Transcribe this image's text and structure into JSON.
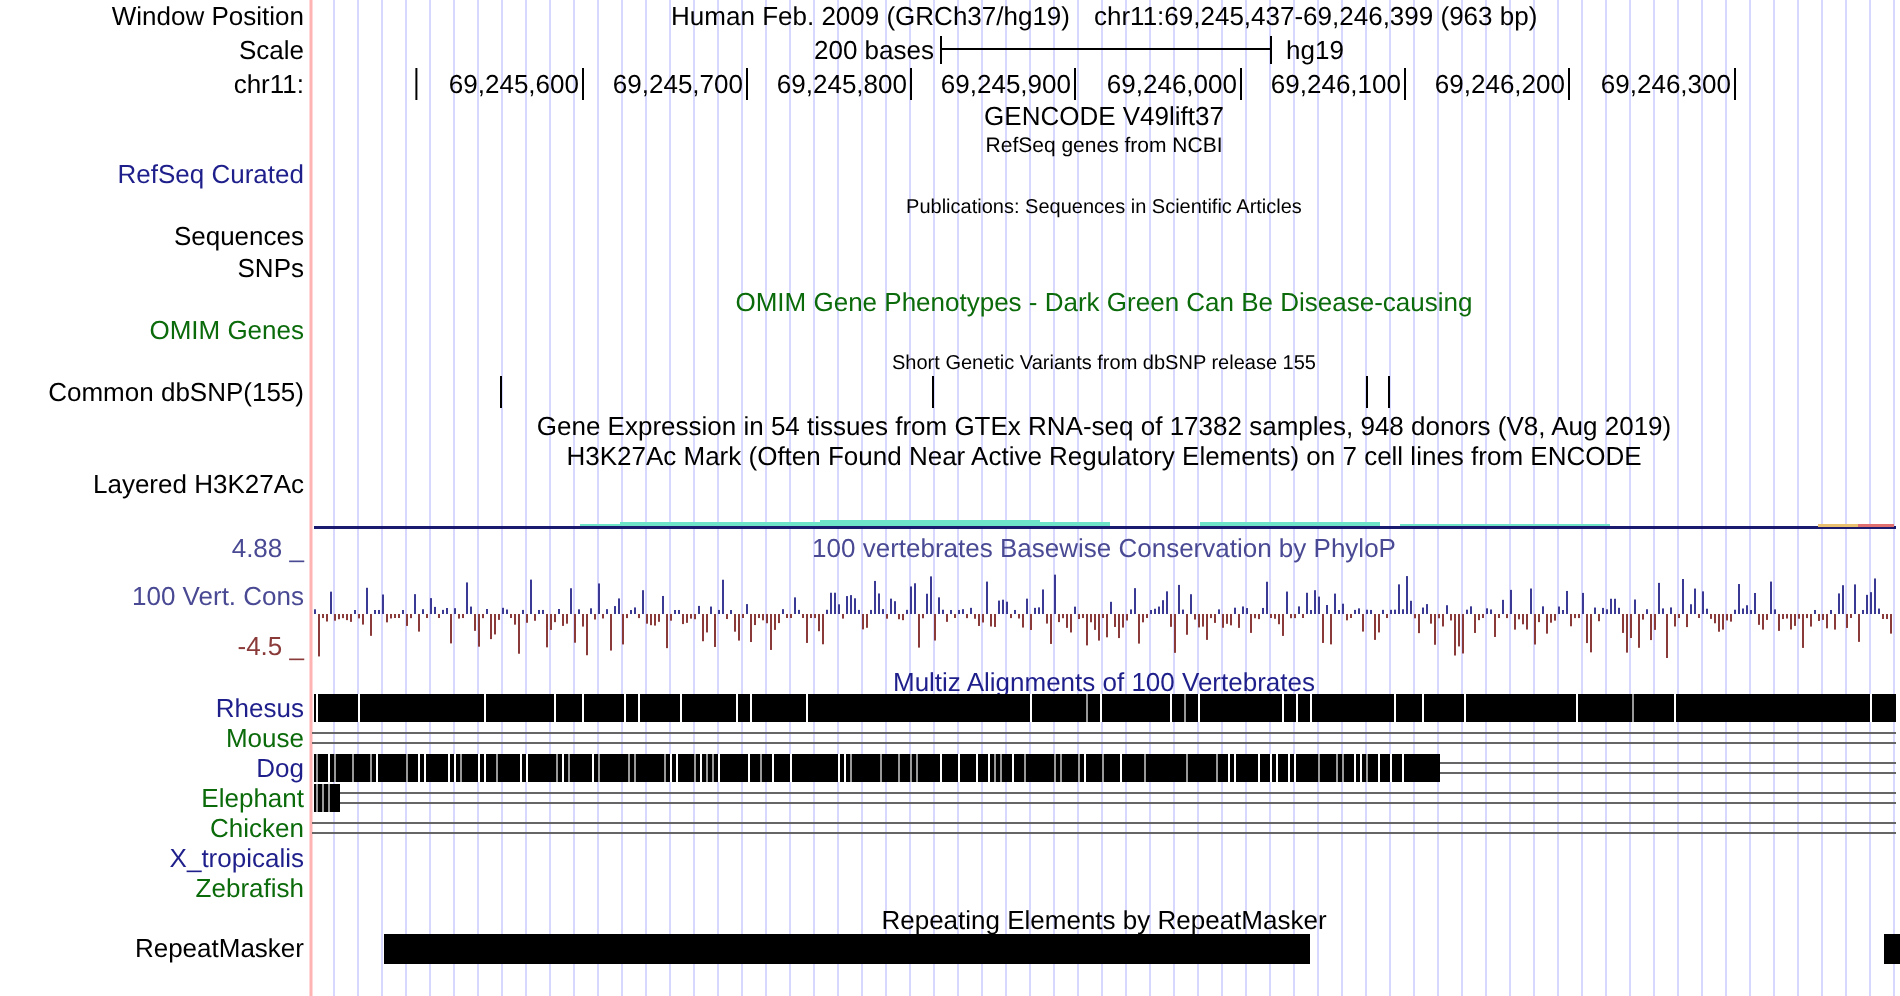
{
  "header": {
    "window_position_label": "Window Position",
    "scale_label": "Scale",
    "chrom_label": "chr11:",
    "assembly": "Human Feb. 2009 (GRCh37/hg19)",
    "position": "chr11:69,245,437-69,246,399 (963 bp)",
    "scale_text": "200 bases",
    "scale_db": "hg19",
    "ruler_ticks": [
      "69,245,600",
      "69,245,700",
      "69,245,800",
      "69,245,900",
      "69,246,000",
      "69,246,100",
      "69,246,200",
      "69,246,300"
    ]
  },
  "tracks": [
    {
      "kind": "gencode",
      "title": "GENCODE V49lift37"
    },
    {
      "kind": "refseq",
      "title": "RefSeq genes from NCBI",
      "label": "RefSeq Curated",
      "color": "#1f1f8c"
    },
    {
      "kind": "publications",
      "title": "Publications: Sequences in Scientific Articles",
      "labels": [
        "Sequences",
        "SNPs"
      ],
      "color": "#000000"
    },
    {
      "kind": "omim",
      "title": "OMIM Gene Phenotypes - Dark Green Can Be Disease-causing",
      "label": "OMIM Genes",
      "color": "#0b6b0b"
    },
    {
      "kind": "snp",
      "title": "Short Genetic Variants from dbSNP release 155",
      "label": "Common dbSNP(155)",
      "color": "#000000"
    },
    {
      "kind": "gtex",
      "title": "Gene Expression in 54 tissues from GTEx RNA-seq of 17382 samples, 948 donors (V8, Aug 2019)"
    },
    {
      "kind": "h3k27ac",
      "title": "H3K27Ac Mark (Often Found Near Active Regulatory Elements) on 7 cell lines from ENCODE",
      "label": "Layered H3K27Ac",
      "color": "#000000"
    },
    {
      "kind": "phylop",
      "title": "100 vertebrates Basewise Conservation by PhyloP",
      "label": "100 Vert. Cons",
      "max_label": "4.88 _",
      "min_label": "-4.5 _",
      "color": "#4a4a94"
    },
    {
      "kind": "multiz",
      "title": "Multiz Alignments of 100 Vertebrates",
      "color": "#1f1f8c",
      "species": [
        {
          "name": "Rhesus",
          "color": "#1f1f8c",
          "kind": "full"
        },
        {
          "name": "Mouse",
          "color": "#0b6b0b",
          "kind": "lines"
        },
        {
          "name": "Dog",
          "color": "#1f1f8c",
          "kind": "partial"
        },
        {
          "name": "Elephant",
          "color": "#0b6b0b",
          "kind": "stub"
        },
        {
          "name": "Chicken",
          "color": "#0b6b0b",
          "kind": "lines"
        },
        {
          "name": "X_tropicalis",
          "color": "#1f1f8c",
          "kind": "none"
        },
        {
          "name": "Zebrafish",
          "color": "#0b6b0b",
          "kind": "none"
        }
      ]
    },
    {
      "kind": "rmsk",
      "title": "Repeating Elements by RepeatMasker",
      "label": "RepeatMasker",
      "color": "#000000"
    }
  ]
}
